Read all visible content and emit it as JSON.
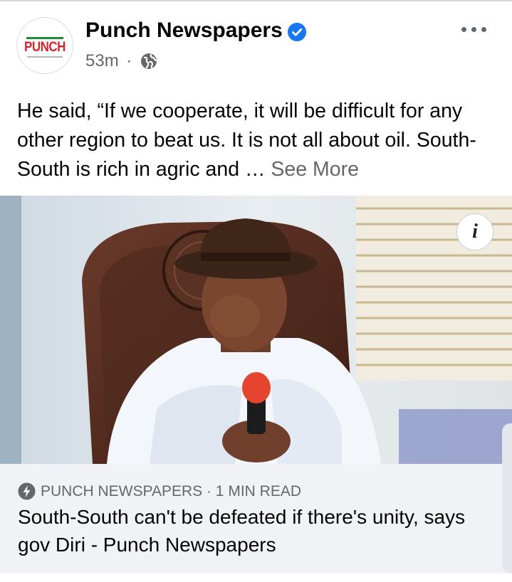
{
  "post": {
    "page_name": "Punch Newspapers",
    "avatar_text": "PUNCH",
    "time": "53m",
    "separator": "·",
    "text": "He said, “If we cooperate, it will be difficult for any other region to beat us. It is not all about oil. South-South is rich in agric and ",
    "ellipsis": "…",
    "see_more": "See More"
  },
  "image": {
    "info_icon": "i"
  },
  "link": {
    "source": "PUNCH NEWSPAPERS · 1 MIN READ",
    "headline": "South-South can't be defeated if there's unity, says gov Diri - Punch Newspapers"
  },
  "colors": {
    "accent": "#1877f2",
    "secondary_text": "#65676b",
    "link_background": "#f0f2f5"
  },
  "icons": [
    "verified-badge-icon",
    "globe-icon",
    "more-options-icon",
    "info-icon",
    "bolt-icon"
  ]
}
